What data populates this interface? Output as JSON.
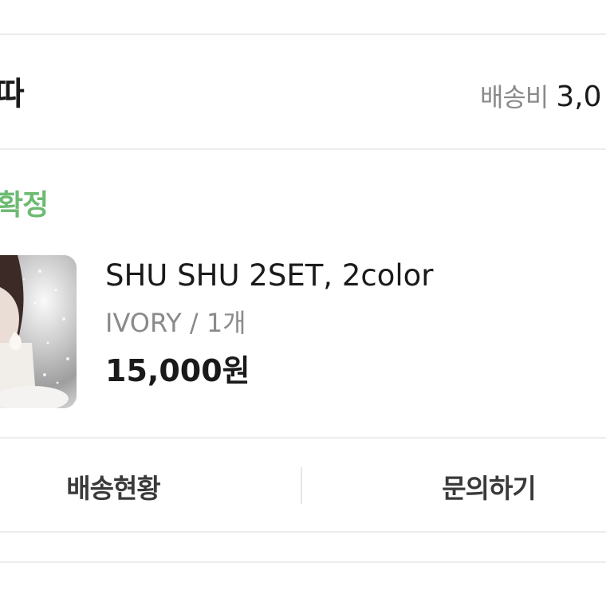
{
  "shop": {
    "name": "따"
  },
  "shipping": {
    "label": "배송비",
    "value": "3,0"
  },
  "order": {
    "status": "확정"
  },
  "product": {
    "name": "SHU SHU 2SET, 2color",
    "option": "IVORY / 1개",
    "price": "15,000원"
  },
  "actions": {
    "track_label": "배송현황",
    "inquiry_label": "문의하기"
  },
  "colors": {
    "status_green": "#6dbb73",
    "text_primary": "#1a1a1a",
    "text_secondary": "#8a8a8a",
    "divider": "#ececec"
  }
}
